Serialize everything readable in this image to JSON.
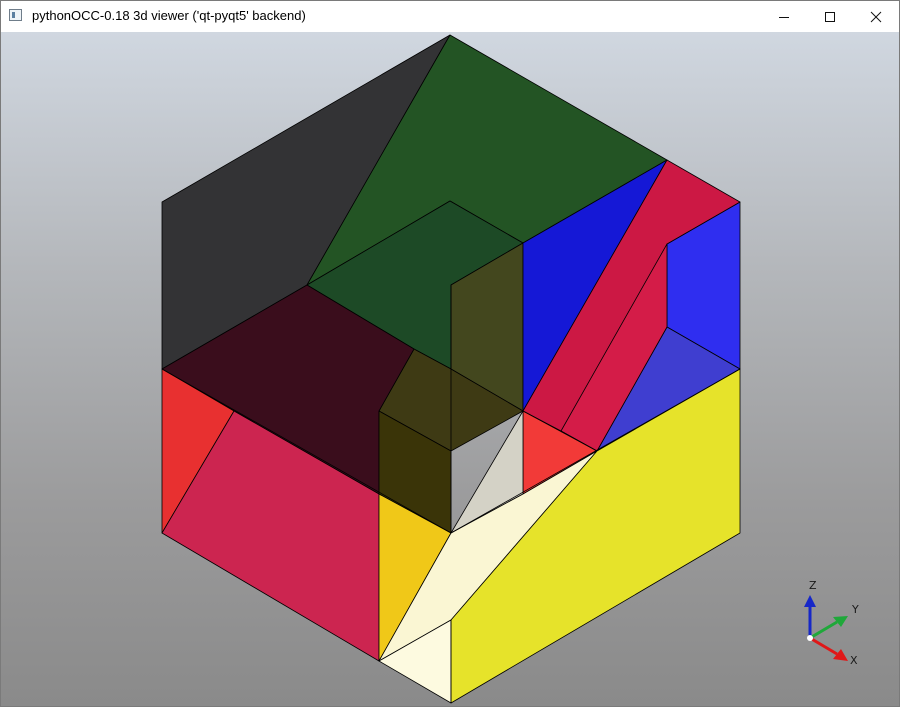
{
  "window": {
    "title": "pythonOCC-0.18 3d viewer ('qt-pyqt5' backend)",
    "controls": [
      "minimize",
      "maximize",
      "close"
    ]
  },
  "viewport": {
    "background": "gradient light-blue-gray to gray",
    "triedron": {
      "labels": {
        "x": "X",
        "y": "Y",
        "z": "Z"
      },
      "colors": {
        "x": "#e01818",
        "y": "#1fa83a",
        "z": "#1627c8"
      }
    },
    "model": {
      "face_colors": {
        "black": "#333335",
        "green": "#235424",
        "blue": "#1518d6",
        "crimson": "#cc1844",
        "dark_red": "#3a0d1c",
        "red": "#e83030",
        "yellow": "#e6e32a",
        "cream": "#faf6d3",
        "olive": "#43471e",
        "gold": "#f0c818"
      }
    }
  }
}
